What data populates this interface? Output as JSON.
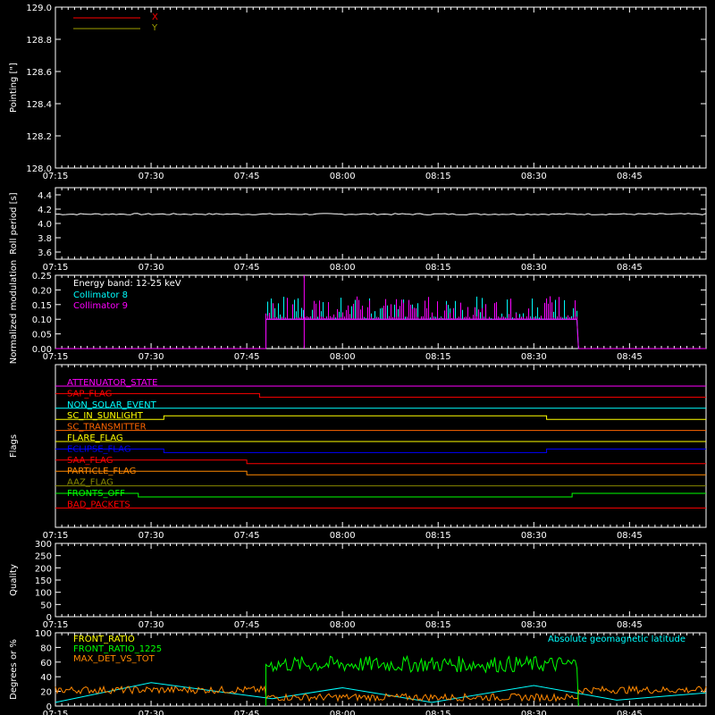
{
  "x_ticks": [
    "07:15",
    "07:30",
    "07:45",
    "08:00",
    "08:15",
    "08:30",
    "08:45"
  ],
  "chart_data": [
    {
      "type": "line",
      "ylabel": "Pointing [\"]",
      "ylim": [
        128.0,
        129.0
      ],
      "yticks": [
        "128.0",
        "128.2",
        "128.4",
        "128.6",
        "128.8",
        "129.0"
      ],
      "legend": [
        "X",
        "Y"
      ],
      "series": [
        {
          "name": "X",
          "color": "#ff0000",
          "x": [],
          "y": []
        },
        {
          "name": "Y",
          "color": "#a0a000",
          "x": [],
          "y": []
        }
      ]
    },
    {
      "type": "line",
      "ylabel": "Roll period [s]",
      "ylim": [
        3.5,
        4.5
      ],
      "yticks": [
        "3.6",
        "3.8",
        "4.0",
        "4.2",
        "4.4"
      ],
      "series": [
        {
          "x": [
            "07:15",
            "08:57"
          ],
          "y": [
            4.13,
            4.13
          ],
          "color": "#ffffff"
        }
      ]
    },
    {
      "type": "line",
      "ylabel": "Normalized modulation",
      "ylim": [
        0,
        0.25
      ],
      "yticks": [
        "0.00",
        "0.05",
        "0.10",
        "0.15",
        "0.20",
        "0.25"
      ],
      "annotation": "Energy band: 12-25 keV",
      "legend": [
        "Collimator 8",
        "Collimator 9"
      ],
      "active_window": [
        "07:48",
        "08:37"
      ],
      "baseline": 0.1,
      "series": [
        {
          "name": "Collimator 8",
          "color": "#00ffff"
        },
        {
          "name": "Collimator 9",
          "color": "#ff00ff"
        }
      ]
    },
    {
      "type": "flags",
      "ylabel": "Flags",
      "flags": [
        {
          "name": "ATTENUATOR_STATE",
          "color": "#ff00ff",
          "steps": []
        },
        {
          "name": "SAP_FLAG",
          "color": "#ff0000",
          "steps": [
            [
              "07:15",
              1
            ],
            [
              "07:47",
              0
            ]
          ]
        },
        {
          "name": "NON_SOLAR_EVENT",
          "color": "#00ffff",
          "steps": []
        },
        {
          "name": "SC_IN_SUNLIGHT",
          "color": "#ffff00",
          "steps": [
            [
              "07:15",
              0
            ],
            [
              "07:32",
              1
            ],
            [
              "08:32",
              0
            ]
          ]
        },
        {
          "name": "SC_TRANSMITTER",
          "color": "#ff6600",
          "steps": []
        },
        {
          "name": "FLARE_FLAG",
          "color": "#ffff00",
          "steps": []
        },
        {
          "name": "ECLIPSE_FLAG",
          "color": "#0000ff",
          "steps": [
            [
              "07:15",
              1
            ],
            [
              "07:32",
              0
            ],
            [
              "08:32",
              1
            ]
          ]
        },
        {
          "name": "SAA_FLAG",
          "color": "#ff0000",
          "steps": [
            [
              "07:15",
              1
            ],
            [
              "07:45",
              0
            ]
          ]
        },
        {
          "name": "PARTICLE_FLAG",
          "color": "#ff8800",
          "steps": [
            [
              "07:15",
              1
            ],
            [
              "07:45",
              0
            ]
          ]
        },
        {
          "name": "AAZ_FLAG",
          "color": "#888800",
          "steps": []
        },
        {
          "name": "FRONTS_OFF",
          "color": "#00ff00",
          "steps": [
            [
              "07:15",
              1
            ],
            [
              "07:28",
              0
            ],
            [
              "08:36",
              1
            ]
          ]
        },
        {
          "name": "BAD_PACKETS",
          "color": "#ff0000",
          "steps": []
        }
      ]
    },
    {
      "type": "line",
      "ylabel": "Quality",
      "ylim": [
        0,
        300
      ],
      "yticks": [
        "0",
        "50",
        "100",
        "150",
        "200",
        "250",
        "300"
      ],
      "series": []
    },
    {
      "type": "line",
      "ylabel": "Degrees or %",
      "ylim": [
        0,
        100
      ],
      "yticks": [
        "0",
        "20",
        "40",
        "60",
        "80",
        "100"
      ],
      "legend": [
        "FRONT_RATIO",
        "FRONT_RATIO_1225",
        "MAX_DET_VS_TOT"
      ],
      "legend_right": "Absolute geomagnetic latitude",
      "series": [
        {
          "name": "FRONT_RATIO",
          "color": "#ffff00",
          "level": 0
        },
        {
          "name": "FRONT_RATIO_1225",
          "color": "#00ff00",
          "level": 57
        },
        {
          "name": "MAX_DET_VS_TOT",
          "color": "#ff8800",
          "level": 22
        },
        {
          "name": "Absolute geomagnetic latitude",
          "color": "#00ffff",
          "x": [
            "07:15",
            "07:30",
            "07:49",
            "08:00",
            "08:14",
            "08:30",
            "08:43",
            "08:57"
          ],
          "y": [
            5,
            32,
            10,
            25,
            5,
            28,
            8,
            18
          ]
        }
      ]
    }
  ]
}
